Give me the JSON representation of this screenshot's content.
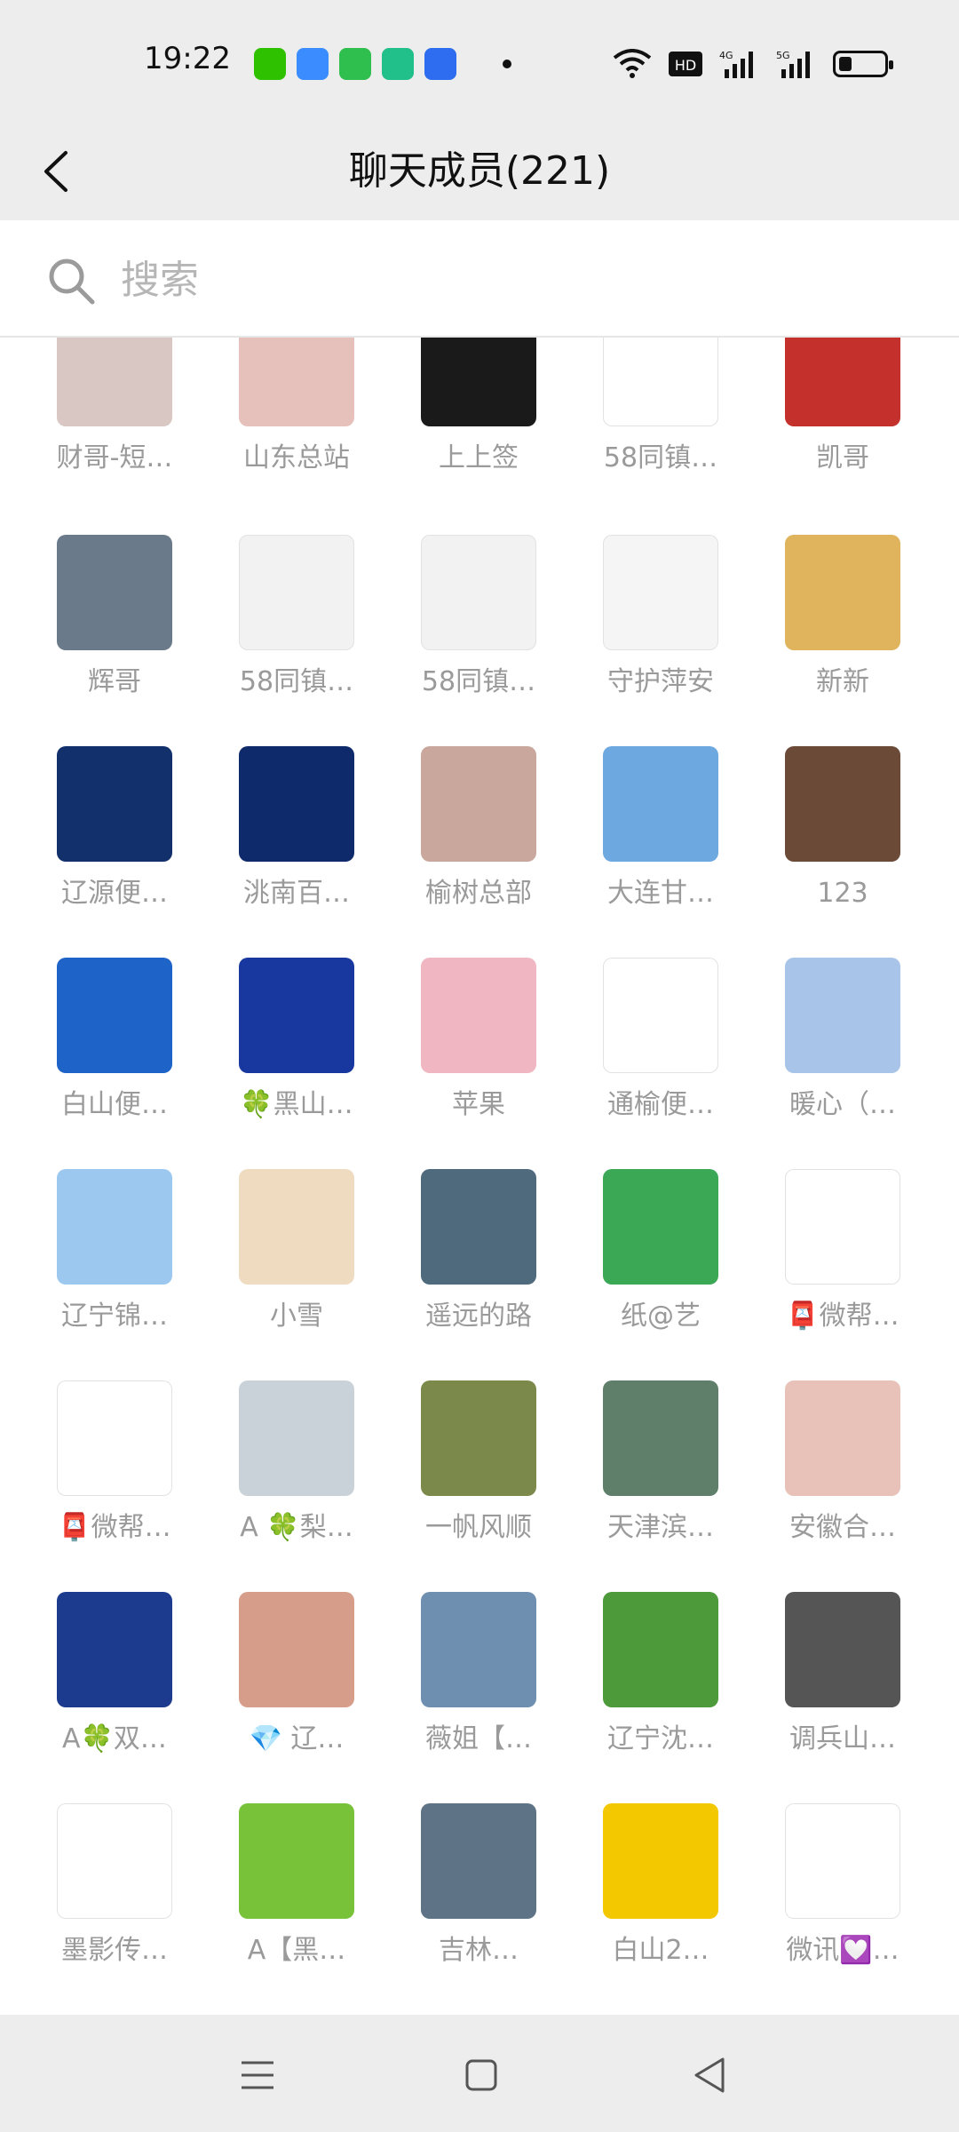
{
  "status_bar": {
    "time": "19:22",
    "notification_icons": [
      "wechat-icon",
      "blue-app-icon",
      "messages-icon",
      "green-app-icon",
      "blue-badge-app-icon"
    ],
    "system_icons": [
      "wifi-icon",
      "hd-icon",
      "signal-4g-icon",
      "signal-5g-icon",
      "battery-icon"
    ]
  },
  "header": {
    "back_icon": "chevron-left-icon",
    "title": "聊天成员(221)"
  },
  "search": {
    "placeholder": "搜索",
    "value": ""
  },
  "members": [
    {
      "name": "财哥-短…",
      "avatar_color": "#d9c7c4"
    },
    {
      "name": "山东总站",
      "avatar_color": "#e6c1bb"
    },
    {
      "name": "上上签",
      "avatar_color": "#1a1a1a"
    },
    {
      "name": "58同镇…",
      "avatar_color": "#ffffff"
    },
    {
      "name": "凯哥",
      "avatar_color": "#c4302b"
    },
    {
      "name": "辉哥",
      "avatar_color": "#6b7a8a"
    },
    {
      "name": "58同镇…",
      "avatar_color": "#f2f2f2"
    },
    {
      "name": "58同镇…",
      "avatar_color": "#f2f2f2"
    },
    {
      "name": "守护萍安",
      "avatar_color": "#f5f5f5"
    },
    {
      "name": "新新",
      "avatar_color": "#e0b45c"
    },
    {
      "name": "辽源便…",
      "avatar_color": "#12306b"
    },
    {
      "name": "洮南百…",
      "avatar_color": "#0f2a6b"
    },
    {
      "name": "榆树总部",
      "avatar_color": "#c9a79c"
    },
    {
      "name": "大连甘…",
      "avatar_color": "#6ea8e0"
    },
    {
      "name": "123",
      "avatar_color": "#6b4a38"
    },
    {
      "name": "白山便…",
      "avatar_color": "#1e63c7"
    },
    {
      "name": "🍀黑山…",
      "avatar_color": "#1838a0"
    },
    {
      "name": "苹果",
      "avatar_color": "#f0b7c2"
    },
    {
      "name": "通榆便…",
      "avatar_color": "#ffffff"
    },
    {
      "name": "暖心（…",
      "avatar_color": "#a8c4e8"
    },
    {
      "name": "辽宁锦…",
      "avatar_color": "#9cc8ef"
    },
    {
      "name": "小雪",
      "avatar_color": "#efdcc0"
    },
    {
      "name": "遥远的路",
      "avatar_color": "#4e6a7c"
    },
    {
      "name": "纸@艺",
      "avatar_color": "#3aa855"
    },
    {
      "name": "📮微帮…",
      "avatar_color": "#ffffff"
    },
    {
      "name": "📮微帮…",
      "avatar_color": "#ffffff"
    },
    {
      "name": "A 🍀梨…",
      "avatar_color": "#c9d2d8"
    },
    {
      "name": "一帆风顺",
      "avatar_color": "#7b8a4a"
    },
    {
      "name": "天津滨…",
      "avatar_color": "#5f7f6a"
    },
    {
      "name": "安徽合…",
      "avatar_color": "#e8c2b8"
    },
    {
      "name": "A🍀双…",
      "avatar_color": "#1c3a8e"
    },
    {
      "name": "💎 辽…",
      "avatar_color": "#d69e8a"
    },
    {
      "name": "薇姐【…",
      "avatar_color": "#6f8fb0"
    },
    {
      "name": "辽宁沈…",
      "avatar_color": "#4d9a3a"
    },
    {
      "name": "调兵山…",
      "avatar_color": "#555555"
    },
    {
      "name": "墨影传…",
      "avatar_color": "#ffffff"
    },
    {
      "name": "A【黑…",
      "avatar_color": "#78c23a"
    },
    {
      "name": "吉林…",
      "avatar_color": "#5e7385"
    },
    {
      "name": "白山2…",
      "avatar_color": "#f3c800"
    },
    {
      "name": "微讯💟…",
      "avatar_color": "#ffffff"
    }
  ],
  "nav_bar": {
    "buttons": [
      "menu-icon",
      "home-icon",
      "back-triangle-icon"
    ]
  },
  "colors": {
    "bar_background": "#ededed",
    "name_text": "#9a9a9a",
    "placeholder": "#b6b6b6"
  }
}
